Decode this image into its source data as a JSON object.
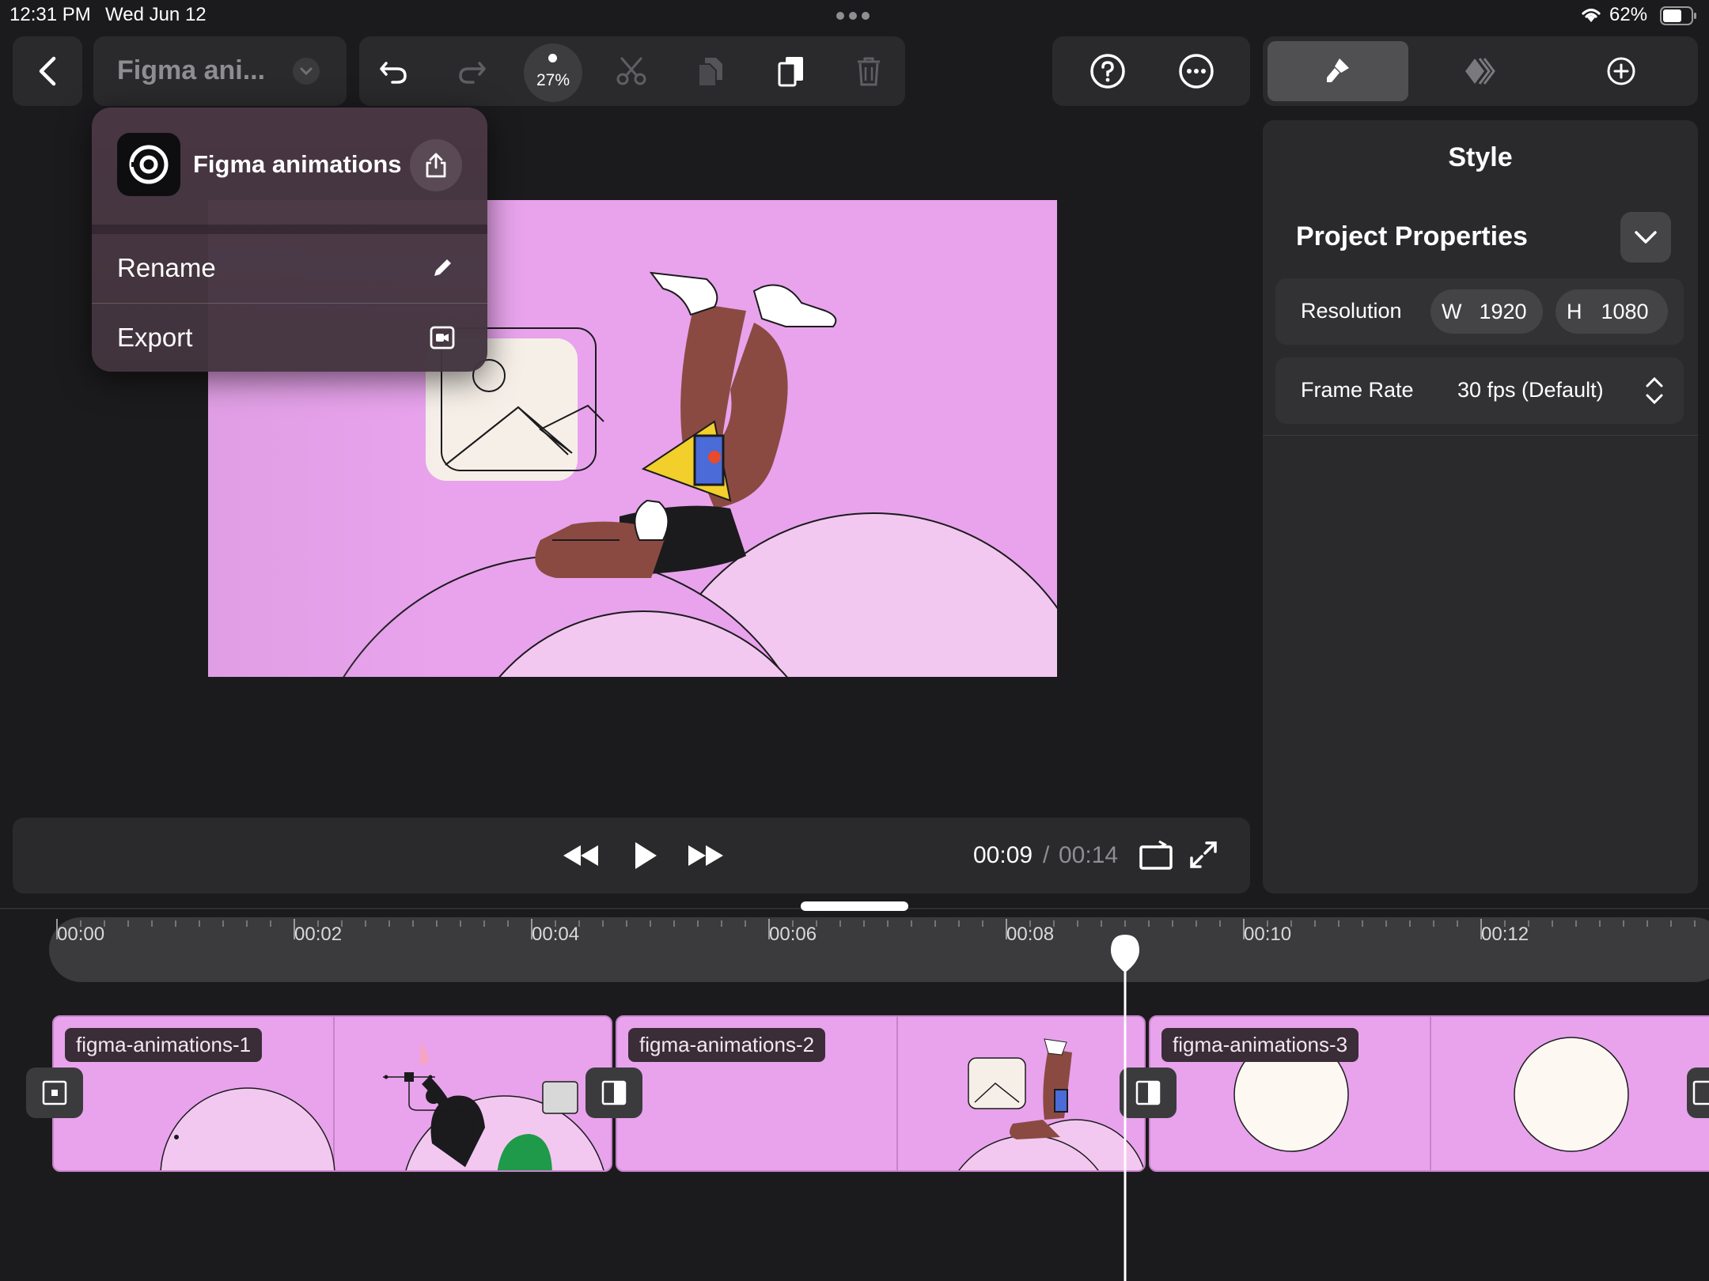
{
  "status_bar": {
    "time": "12:31 PM",
    "date": "Wed Jun 12",
    "battery": "62%"
  },
  "toolbar": {
    "project_title": "Figma ani...",
    "zoom": "27%"
  },
  "menu": {
    "project_name": "Figma animations",
    "items": [
      {
        "label": "Rename",
        "icon": "pencil-icon"
      },
      {
        "label": "Export",
        "icon": "export-video-icon"
      }
    ]
  },
  "inspector": {
    "tab_title": "Style",
    "section_title": "Project Properties",
    "resolution_label": "Resolution",
    "width_prefix": "W",
    "width_value": "1920",
    "height_prefix": "H",
    "height_value": "1080",
    "frame_rate_label": "Frame Rate",
    "frame_rate_value": "30 fps (Default)"
  },
  "playback": {
    "current_time": "00:09",
    "separator": "/",
    "total_time": "00:14",
    "progress_fraction": 0.6429
  },
  "timeline": {
    "ruler_labels": [
      "00:00",
      "00:02",
      "00:04",
      "00:06",
      "00:08",
      "00:10",
      "00:12"
    ],
    "clips": [
      {
        "label": "figma-animations-1"
      },
      {
        "label": "figma-animations-2"
      },
      {
        "label": "figma-animations-3"
      }
    ]
  },
  "colors": {
    "canvas_pink": "#e8a3ec",
    "canvas_light_pink": "#f3c8f0",
    "panel": "#2a2a2c",
    "background": "#1b1b1d"
  }
}
